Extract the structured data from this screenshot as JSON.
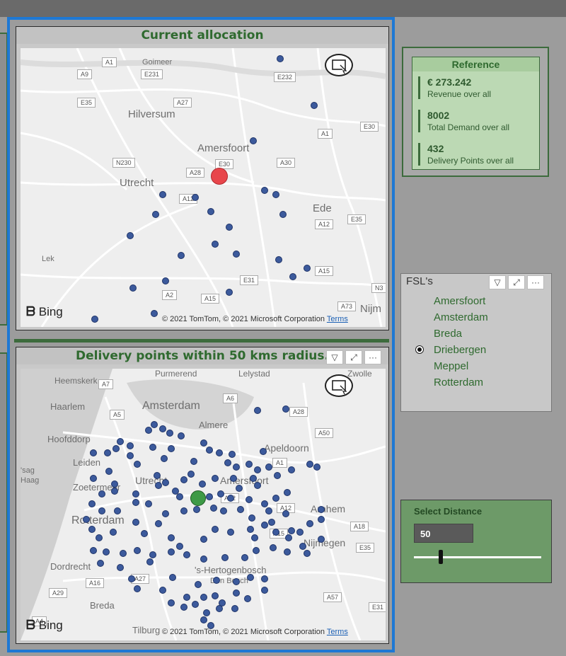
{
  "current_allocation": {
    "title": "Current allocation",
    "labels": [
      "Goimeer",
      "Hilversum",
      "Amersfoort",
      "Utrecht",
      "Ede",
      "Lek",
      "Nijm"
    ],
    "roads": [
      "A1",
      "A9",
      "E231",
      "E35",
      "A27",
      "E232",
      "A1",
      "E30",
      "N230",
      "A28",
      "E30",
      "A30",
      "A12",
      "A12",
      "E35",
      "E31",
      "A15",
      "A2",
      "A15",
      "A73",
      "N3"
    ],
    "copyright": "© 2021 TomTom, © 2021 Microsoft Corporation",
    "terms": "Terms",
    "bing": "Bing",
    "highlight_color": "#e8464b"
  },
  "delivery_points": {
    "title": "Delivery points within 50 kms radius.",
    "labels": [
      "Purmerend",
      "Lelystad",
      "Heemskerk",
      "Haarlem",
      "Amsterdam",
      "Hoofddorp",
      "Leiden",
      "Zoetermeer",
      "Rotterdam",
      "Dordrecht",
      "Breda",
      "Tilburg",
      "Utrecht",
      "Amersfoort",
      "Apeldoorn",
      "Arnhem",
      "Nijmegen",
      "'s-Hertogenbosch",
      "Den Bosch",
      "Almere",
      "Zwolle",
      "'sag",
      "Haag"
    ],
    "roads": [
      "A7",
      "A6",
      "A5",
      "A28",
      "A50",
      "A1",
      "A12",
      "A12",
      "A18",
      "A15",
      "E35",
      "A27",
      "A16",
      "A29",
      "A4",
      "A57",
      "E31",
      "A15"
    ],
    "copyright": "© 2021 TomTom, © 2021 Microsoft Corporation",
    "terms": "Terms",
    "bing": "Bing",
    "highlight_color": "#3e9a46"
  },
  "reference": {
    "title": "Reference",
    "kpis": [
      {
        "value": "€ 273.242",
        "label": "Revenue over all"
      },
      {
        "value": "8002",
        "label": "Total Demand over all"
      },
      {
        "value": "432",
        "label": "Delivery Points over all"
      }
    ]
  },
  "fsl": {
    "title": "FSL's",
    "options": [
      "Amersfoort",
      "Amsterdam",
      "Breda",
      "Driebergen",
      "Meppel",
      "Rotterdam"
    ],
    "selected": "Driebergen"
  },
  "distance": {
    "title": "Select Distance",
    "value": "50",
    "slider_fraction": 0.2
  },
  "icons": [
    "filter-icon",
    "focus-mode-icon",
    "more-options-icon",
    "focus-view-icon",
    "bing-logo-icon"
  ],
  "colors": {
    "accent_green": "#2f6a2f",
    "selection_blue": "#1e78d4",
    "dot_blue": "#3c5a9c"
  }
}
